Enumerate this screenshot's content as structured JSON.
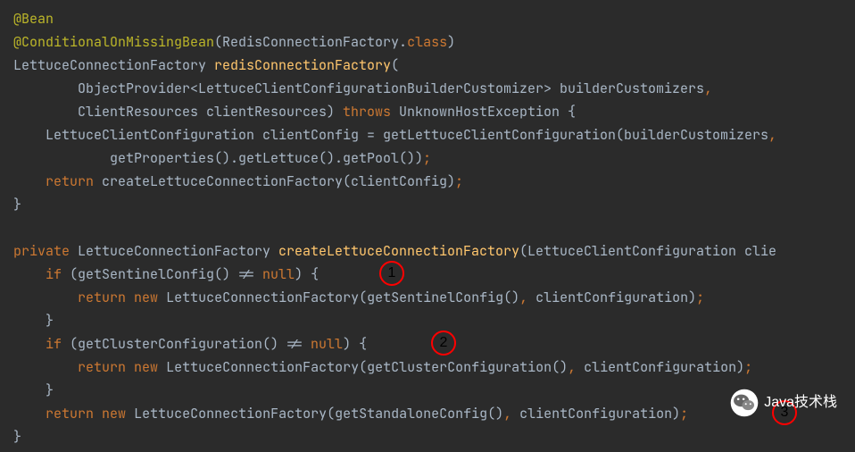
{
  "code": {
    "l1_annotation": "@Bean",
    "l2_annotation": "@ConditionalOnMissingBean",
    "l2_paren_open": "(",
    "l2_class_ref": "RedisConnectionFactory",
    "l2_dot": ".",
    "l2_class_kw": "class",
    "l2_paren_close": ")",
    "l3_type": "LettuceConnectionFactory ",
    "l3_method": "redisConnectionFactory",
    "l3_paren": "(",
    "l4_indent": "        ",
    "l4_text": "ObjectProvider<LettuceClientConfigurationBuilderCustomizer> builderCustomizers",
    "l4_comma": ",",
    "l5_indent": "        ",
    "l5_text1": "ClientResources clientResources) ",
    "l5_throws": "throws",
    "l5_text2": " UnknownHostException {",
    "l6_indent": "    ",
    "l6_text": "LettuceClientConfiguration clientConfig = getLettuceClientConfiguration(builderCustomizers",
    "l6_comma": ",",
    "l7_indent": "            ",
    "l7_text": "getProperties().getLettuce().getPool())",
    "l7_semi": ";",
    "l8_indent": "    ",
    "l8_return": "return",
    "l8_text": " createLettuceConnectionFactory(clientConfig)",
    "l8_semi": ";",
    "l9_brace": "}",
    "l11_private": "private",
    "l11_type": " LettuceConnectionFactory ",
    "l11_method": "createLettuceConnectionFactory",
    "l11_params": "(LettuceClientConfiguration clie",
    "l12_indent": "    ",
    "l12_if": "if",
    "l12_text1": " (getSentinelConfig() != ",
    "l12_null": "null",
    "l12_text2": ") {",
    "l13_indent": "        ",
    "l13_return": "return",
    "l13_space": " ",
    "l13_new": "new",
    "l13_text": " LettuceConnectionFactory(getSentinelConfig()",
    "l13_comma": ",",
    "l13_text2": " clientConfiguration)",
    "l13_semi": ";",
    "l14_indent": "    ",
    "l14_brace": "}",
    "l15_indent": "    ",
    "l15_if": "if",
    "l15_text1": " (getClusterConfiguration() != ",
    "l15_null": "null",
    "l15_text2": ") {",
    "l16_indent": "        ",
    "l16_return": "return",
    "l16_space": " ",
    "l16_new": "new",
    "l16_text": " LettuceConnectionFactory(getClusterConfiguration()",
    "l16_comma": ",",
    "l16_text2": " clientConfiguration)",
    "l16_semi": ";",
    "l17_indent": "    ",
    "l17_brace": "}",
    "l18_indent": "    ",
    "l18_return": "return",
    "l18_space": " ",
    "l18_new": "new",
    "l18_text": " LettuceConnectionFactory(getStandaloneConfig()",
    "l18_comma": ",",
    "l18_text2": " clientConfiguration)",
    "l18_semi": ";",
    "l19_brace": "}"
  },
  "markers": {
    "m1": "1",
    "m2": "2",
    "m3": "3"
  },
  "watermark": {
    "text": "Java技术栈"
  }
}
